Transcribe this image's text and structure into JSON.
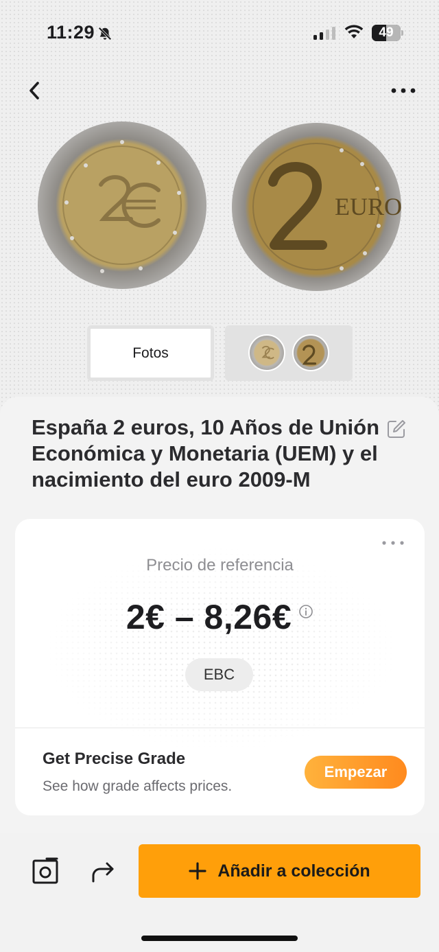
{
  "status_bar": {
    "time": "11:29",
    "battery_percent": "49",
    "battery_level": 0.49
  },
  "coin": {
    "front_icon": "coin-obverse-image",
    "back_icon": "coin-reverse-image",
    "back_text": "EURO"
  },
  "segments": {
    "photos_label": "Fotos"
  },
  "detail": {
    "title": "España 2 euros, 10 Años de Unión Económica y Monetaria (UEM) y el nacimiento del euro 2009-M",
    "price_label": "Precio de referencia",
    "price_range": "2€ – 8,26€",
    "grade": "EBC"
  },
  "grade_promo": {
    "title": "Get Precise Grade",
    "subtitle": "See how grade affects prices.",
    "button": "Empezar"
  },
  "actions": {
    "add_label": "Añadir a colección"
  },
  "colors": {
    "accent": "#ff9f0a",
    "start_gradient_from": "#ffb23c",
    "start_gradient_to": "#ff8a1e"
  }
}
